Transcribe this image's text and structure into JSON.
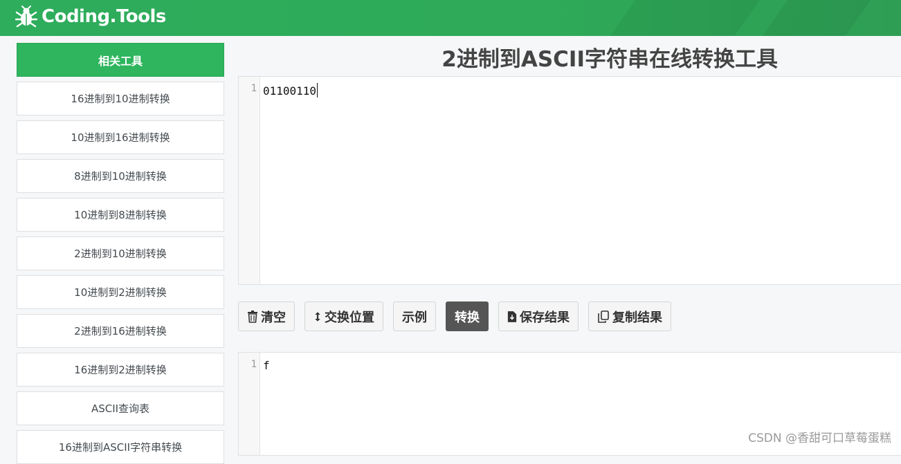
{
  "header": {
    "logo_text": "Coding.Tools",
    "logo_icon": "bug-icon"
  },
  "sidebar": {
    "heading": "相关工具",
    "items": [
      {
        "label": "16进制到10进制转换"
      },
      {
        "label": "10进制到16进制转换"
      },
      {
        "label": "8进制到10进制转换"
      },
      {
        "label": "10进制到8进制转换"
      },
      {
        "label": "2进制到10进制转换"
      },
      {
        "label": "10进制到2进制转换"
      },
      {
        "label": "2进制到16进制转换"
      },
      {
        "label": "16进制到2进制转换"
      },
      {
        "label": "ASCII查询表"
      },
      {
        "label": "16进制到ASCII字符串转换"
      }
    ]
  },
  "main": {
    "title": "2进制到ASCII字符串在线转换工具",
    "input_editor": {
      "line_number": "1",
      "value": "01100110"
    },
    "output_editor": {
      "line_number": "1",
      "value": "f"
    },
    "toolbar": {
      "clear_label": "清空",
      "clear_icon": "trash-icon",
      "swap_label": "交换位置",
      "swap_icon": "swap-vertical-icon",
      "example_label": "示例",
      "convert_label": "转换",
      "save_label": "保存结果",
      "save_icon": "file-download-icon",
      "copy_label": "复制结果",
      "copy_icon": "copy-icon"
    }
  },
  "watermark": "CSDN @香甜可口草莓蛋糕",
  "colors": {
    "header_green": "#2eaa58",
    "sidebar_head_green": "#2eb55e",
    "primary_button": "#555555"
  }
}
